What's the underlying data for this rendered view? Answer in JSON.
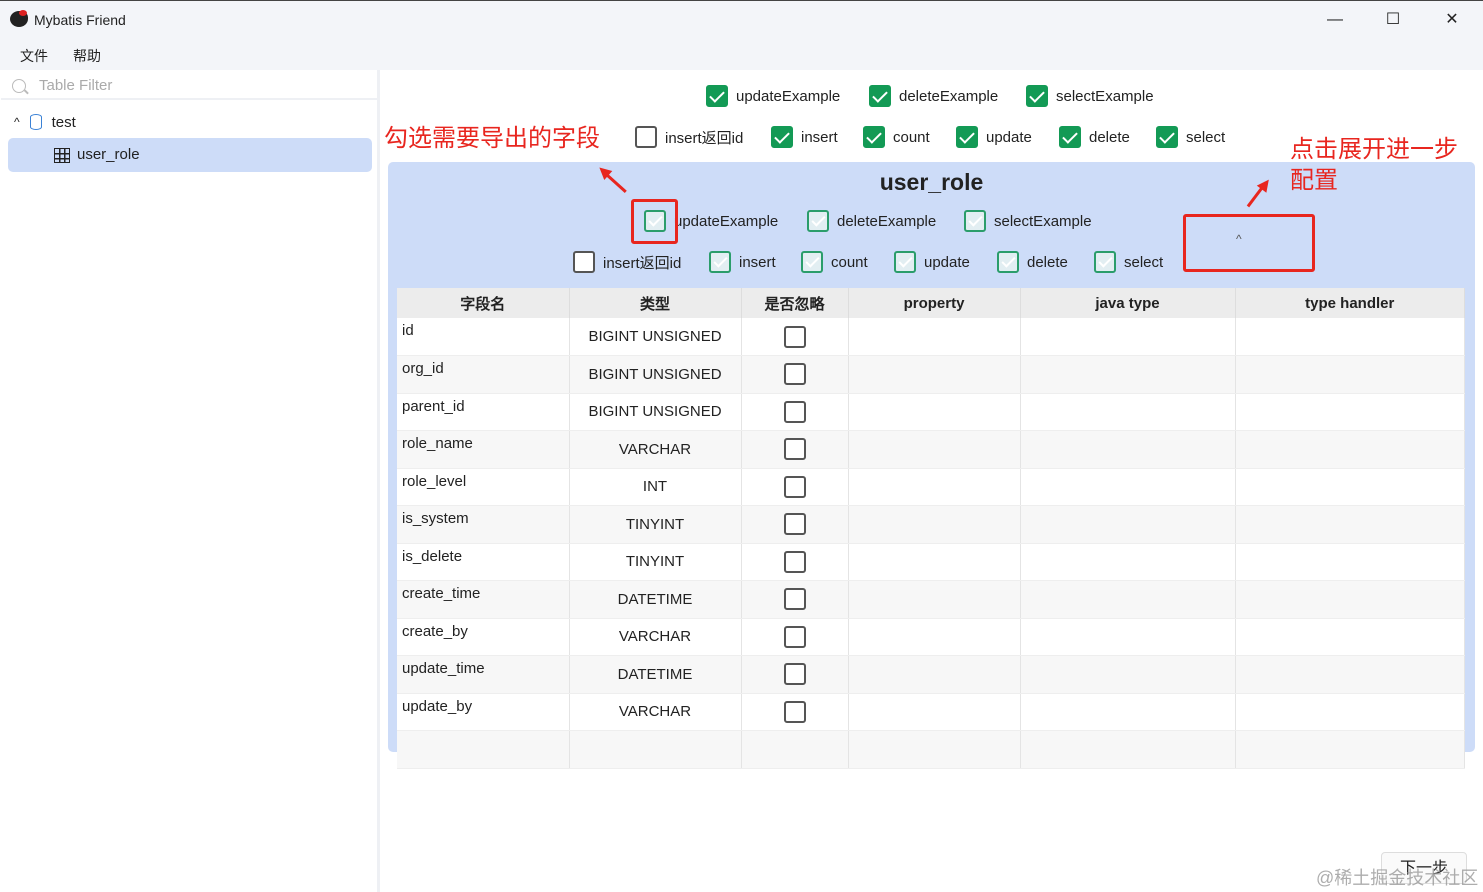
{
  "window": {
    "title": "Mybatis Friend",
    "minimize": "—",
    "maximize": "☐",
    "close": "✕"
  },
  "menu": [
    "文件",
    "帮助"
  ],
  "sidebar": {
    "filter_placeholder": "Table Filter",
    "db": "test",
    "table": "user_role"
  },
  "global_options": {
    "row1": [
      {
        "label": "updateExample",
        "checked": true
      },
      {
        "label": "deleteExample",
        "checked": true
      },
      {
        "label": "selectExample",
        "checked": true
      }
    ],
    "row2": [
      {
        "label": "insert返回id",
        "checked": false
      },
      {
        "label": "insert",
        "checked": true
      },
      {
        "label": "count",
        "checked": true
      },
      {
        "label": "update",
        "checked": true
      },
      {
        "label": "delete",
        "checked": true
      },
      {
        "label": "select",
        "checked": true
      }
    ]
  },
  "panel": {
    "title": "user_role",
    "expand_icon": "chevron-up",
    "row1": [
      {
        "label": "updateExample",
        "checked": true
      },
      {
        "label": "deleteExample",
        "checked": true
      },
      {
        "label": "selectExample",
        "checked": true
      }
    ],
    "row2": [
      {
        "label": "insert返回id",
        "checked": false
      },
      {
        "label": "insert",
        "checked": true
      },
      {
        "label": "count",
        "checked": true
      },
      {
        "label": "update",
        "checked": true
      },
      {
        "label": "delete",
        "checked": true
      },
      {
        "label": "select",
        "checked": true
      }
    ],
    "columns": [
      "字段名",
      "类型",
      "是否忽略",
      "property",
      "java type",
      "type handler"
    ],
    "rows": [
      {
        "name": "id",
        "type": "BIGINT UNSIGNED",
        "ignore": false
      },
      {
        "name": "org_id",
        "type": "BIGINT UNSIGNED",
        "ignore": false
      },
      {
        "name": "parent_id",
        "type": "BIGINT UNSIGNED",
        "ignore": false
      },
      {
        "name": "role_name",
        "type": "VARCHAR",
        "ignore": false
      },
      {
        "name": "role_level",
        "type": "INT",
        "ignore": false
      },
      {
        "name": "is_system",
        "type": "TINYINT",
        "ignore": false
      },
      {
        "name": "is_delete",
        "type": "TINYINT",
        "ignore": false
      },
      {
        "name": "create_time",
        "type": "DATETIME",
        "ignore": false
      },
      {
        "name": "create_by",
        "type": "VARCHAR",
        "ignore": false
      },
      {
        "name": "update_time",
        "type": "DATETIME",
        "ignore": false
      },
      {
        "name": "update_by",
        "type": "VARCHAR",
        "ignore": false
      }
    ]
  },
  "annotations": {
    "left": "勾选需要导出的字段",
    "right_line1": "点击展开进一步",
    "right_line2": "配置"
  },
  "next_button": "下一步",
  "watermark": "@稀土掘金技术社区",
  "colors": {
    "accent_green": "#139a55",
    "panel_bg": "#cddcf8",
    "annotation_red": "#e8261f"
  }
}
